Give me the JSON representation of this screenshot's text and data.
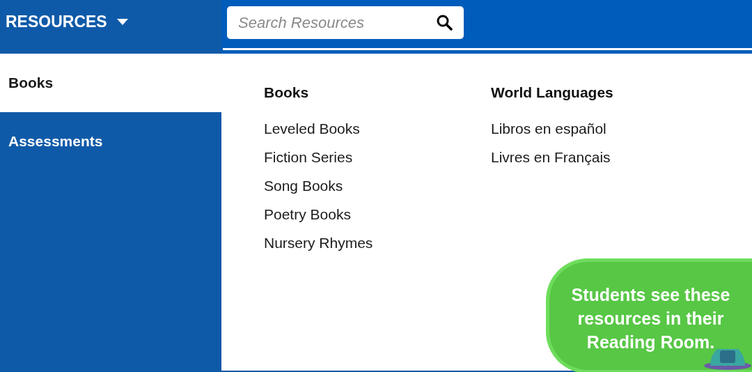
{
  "header": {
    "menu_label": "RESOURCES",
    "search": {
      "placeholder": "Search Resources"
    }
  },
  "sidebar": {
    "items": [
      {
        "label": "Books",
        "selected": true
      },
      {
        "label": "Assessments",
        "selected": false
      }
    ]
  },
  "columns": [
    {
      "heading": "Books",
      "links": [
        "Leveled Books",
        "Fiction Series",
        "Song Books",
        "Poetry Books",
        "Nursery Rhymes"
      ]
    },
    {
      "heading": "World Languages",
      "links": [
        "Libros en español",
        "Livres en Français"
      ]
    }
  ],
  "callout": {
    "text": "Students see these resources in their Reading Room."
  }
}
